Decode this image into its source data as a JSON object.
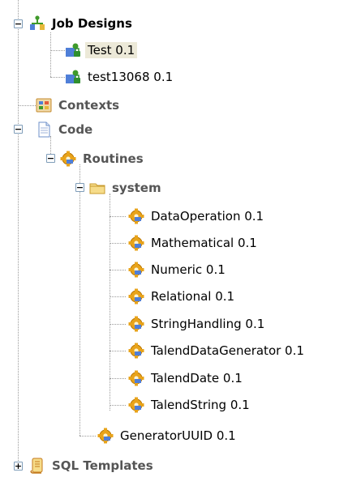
{
  "tree": {
    "job_designs": {
      "label": "Job Designs",
      "children": [
        {
          "label": "Test 0.1",
          "selected": true
        },
        {
          "label": "test13068 0.1"
        }
      ]
    },
    "contexts": {
      "label": "Contexts"
    },
    "code": {
      "label": "Code",
      "routines": {
        "label": "Routines",
        "system": {
          "label": "system",
          "items": [
            {
              "label": "DataOperation 0.1"
            },
            {
              "label": "Mathematical 0.1"
            },
            {
              "label": "Numeric 0.1"
            },
            {
              "label": "Relational 0.1"
            },
            {
              "label": "StringHandling 0.1"
            },
            {
              "label": "TalendDataGenerator 0.1"
            },
            {
              "label": "TalendDate 0.1"
            },
            {
              "label": "TalendString 0.1"
            }
          ]
        },
        "generator": {
          "label": "GeneratorUUID 0.1"
        }
      }
    },
    "sql_templates": {
      "label": "SQL Templates"
    }
  },
  "colors": {
    "selection_bg": "#ece9d8",
    "tree_lines": "#9a9a9a",
    "toggle_border": "#7f9db9"
  },
  "icons": {
    "collapse": "minus",
    "expand": "plus"
  }
}
